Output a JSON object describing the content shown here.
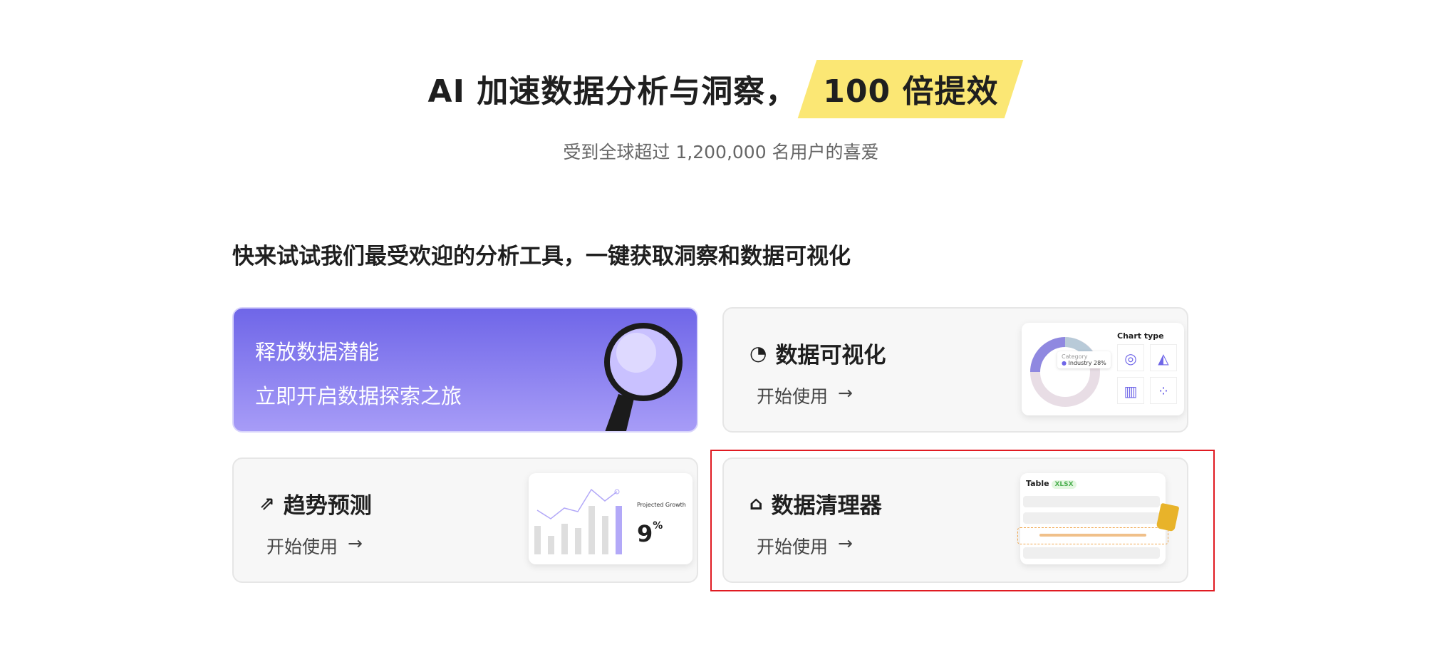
{
  "hero": {
    "title": "AI 加速数据分析与洞察，",
    "highlight": "100 倍提效",
    "subtitle": "受到全球超过 1,200,000 名用户的喜爱",
    "highlight_color": "#fbe774"
  },
  "section_title": "快来试试我们最受欢迎的分析工具，一键获取洞察和数据可视化",
  "promo": {
    "line1": "释放数据潜能",
    "line2": "立即开启数据探索之旅",
    "gradient": [
      "#6f66e8",
      "#a79cf7"
    ]
  },
  "cards": [
    {
      "title": "数据可视化",
      "icon": "chart-pie-icon",
      "cta": "开始使用",
      "preview": {
        "chart_type_label": "Chart type",
        "tooltip_label": "Category",
        "tooltip_item": "Industry",
        "tooltip_value": "28%"
      }
    },
    {
      "title": "趋势预测",
      "icon": "trend-up-icon",
      "cta": "开始使用",
      "preview": {
        "label": "Projected Growth",
        "value": "9",
        "unit": "%"
      }
    },
    {
      "title": "数据清理器",
      "icon": "broom-icon",
      "cta": "开始使用",
      "preview": {
        "table_label": "Table",
        "badge": "XLSX"
      }
    }
  ],
  "accent": "#8b7ff0"
}
